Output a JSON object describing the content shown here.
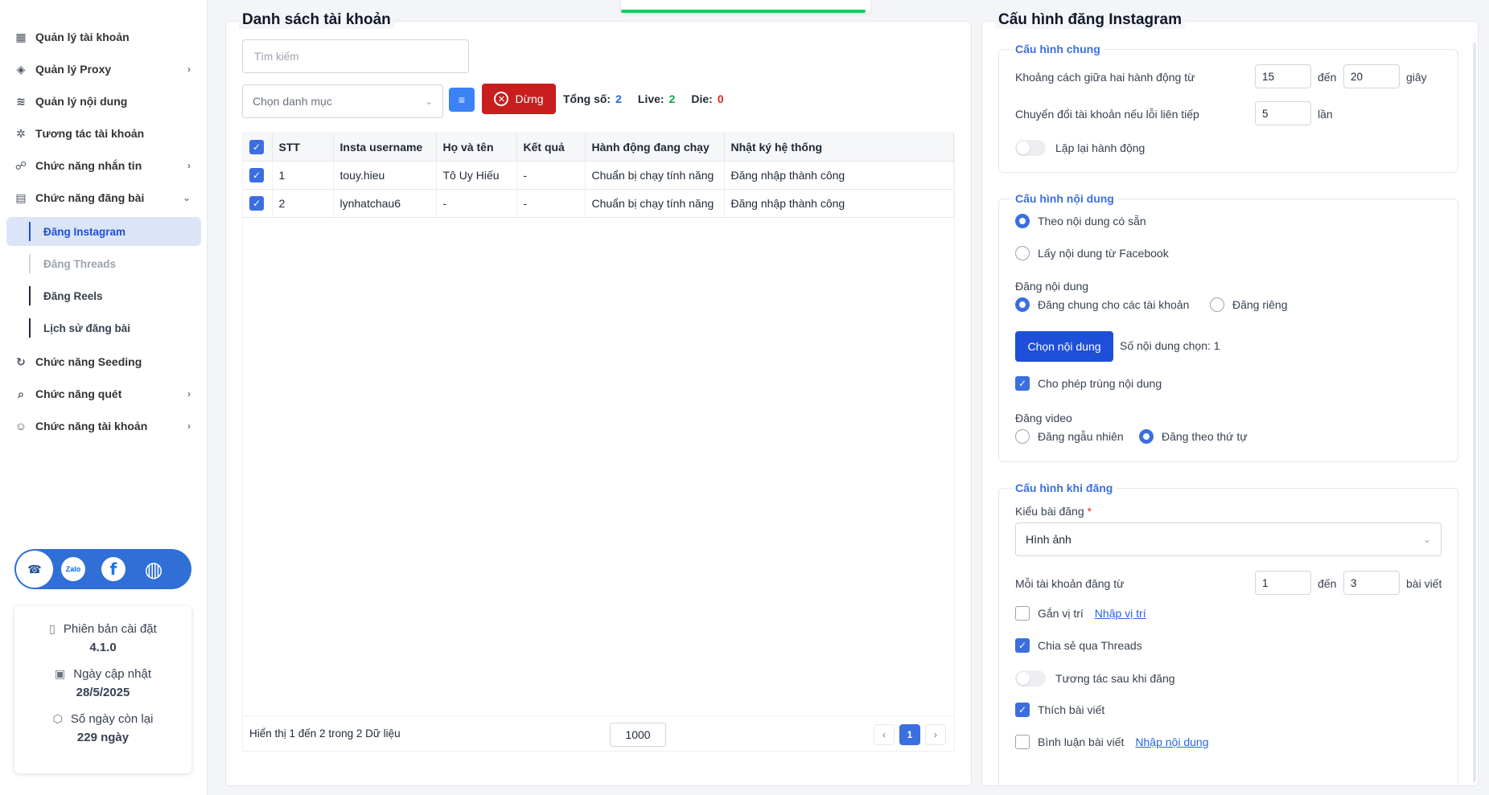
{
  "sidebar": {
    "items": [
      {
        "label": "Quản lý tài khoản",
        "icon": "grid-icon",
        "chevron": ""
      },
      {
        "label": "Quản lý Proxy",
        "icon": "layers-icon",
        "chevron": "›"
      },
      {
        "label": "Quản lý nội dung",
        "icon": "stack-icon",
        "chevron": ""
      },
      {
        "label": "Tương tác tài khoản",
        "icon": "sparkle-icon",
        "chevron": ""
      },
      {
        "label": "Chức năng nhắn tin",
        "icon": "chat-icon",
        "chevron": "›"
      },
      {
        "label": "Chức năng đăng bài",
        "icon": "document-icon",
        "chevron": "⌄"
      }
    ],
    "sub_items": [
      {
        "label": "Đăng Instagram"
      },
      {
        "label": "Đăng Threads"
      },
      {
        "label": "Đăng Reels"
      },
      {
        "label": "Lịch sử đăng bài"
      }
    ],
    "items_after": [
      {
        "label": "Chức năng Seeding",
        "icon": "refresh-icon",
        "chevron": ""
      },
      {
        "label": "Chức năng quét",
        "icon": "scan-icon",
        "chevron": "›"
      },
      {
        "label": "Chức năng tài khoản",
        "icon": "user-icon",
        "chevron": "›"
      }
    ],
    "social": {
      "zalo": "Zalo",
      "facebook": "f"
    },
    "info": {
      "version_label": "Phiên bản cài đặt",
      "version_value": "4.1.0",
      "update_label": "Ngày cập nhật",
      "update_value": "28/5/2025",
      "days_label": "Số ngày còn lại",
      "days_value": "229 ngày"
    }
  },
  "accounts": {
    "title": "Danh sách tài khoản",
    "search_placeholder": "Tìm kiếm",
    "category_placeholder": "Chọn danh mục",
    "stop_label": "Dừng",
    "total_label": "Tổng số:",
    "total_value": "2",
    "live_label": "Live:",
    "live_value": "2",
    "die_label": "Die:",
    "die_value": "0",
    "columns": [
      "STT",
      "Insta username",
      "Họ và tên",
      "Kết quả",
      "Hành động đang chạy",
      "Nhật ký hệ thống"
    ],
    "rows": [
      {
        "stt": "1",
        "username": "touy.hieu",
        "name": "Tô Uy Hiếu",
        "result": "-",
        "action": "Chuẩn bị chạy tính năng",
        "log": "Đăng nhập thành công"
      },
      {
        "stt": "2",
        "username": "lynhatchau6",
        "name": "-",
        "result": "-",
        "action": "Chuẩn bị chạy tính năng",
        "log": "Đăng nhập thành công"
      }
    ],
    "footer_text": "Hiển thị 1 đến 2 trong 2 Dữ liệu",
    "page_size": "1000",
    "current_page": "1"
  },
  "config": {
    "title": "Cấu hình đăng Instagram",
    "general": {
      "title": "Cấu hình chung",
      "interval_label": "Khoảng cách giữa hai hành động từ",
      "interval_from": "15",
      "to_label": "đến",
      "interval_to": "20",
      "seconds_label": "giây",
      "switch_label": "Chuyển đổi tài khoản nếu lỗi liên tiếp",
      "switch_value": "5",
      "times_label": "lần",
      "repeat_label": "Lặp lại hành động"
    },
    "content": {
      "title": "Cấu hình nội dung",
      "opt_existing": "Theo nội dung có sẵn",
      "opt_facebook": "Lấy nội dung từ Facebook",
      "post_content_label": "Đăng nội dung",
      "opt_shared": "Đăng chung cho các tài khoản",
      "opt_separate": "Đăng riêng",
      "choose_button": "Chọn nội dung",
      "selected_count": "Số nội dung chọn: 1",
      "allow_duplicate": "Cho phép trùng nội dung",
      "post_video_label": "Đăng video",
      "opt_random": "Đăng ngẫu nhiên",
      "opt_order": "Đăng theo thứ tự"
    },
    "posting": {
      "title": "Cấu hình khi đăng",
      "post_type_label": "Kiểu bài đăng",
      "required": "*",
      "post_type_value": "Hình ảnh",
      "per_account_label": "Mỗi tài khoản đăng từ",
      "per_from": "1",
      "to_label": "đến",
      "per_to": "3",
      "posts_label": "bài viết",
      "attach_location": "Gắn vị trí",
      "enter_location": "Nhập vị trí",
      "share_threads": "Chia sẻ qua Threads",
      "interact_after": "Tương tác sau khi đăng",
      "like_post": "Thích bài viết",
      "comment_post": "Bình luận bài viết",
      "enter_content": "Nhập nội dung"
    }
  },
  "colors": {
    "accent": "#3b6fe0",
    "danger": "#c81e1e",
    "success": "#22c55e"
  }
}
